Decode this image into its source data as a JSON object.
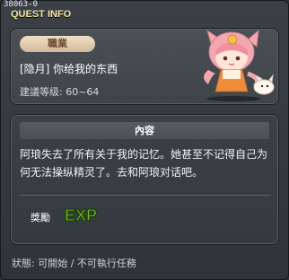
{
  "window": {
    "id": "38063-0",
    "title": "QUEST INFO"
  },
  "profile": {
    "job_badge": "職業",
    "quest_name": "[隐月] 你给我的东西",
    "level_range": "建議等级: 60~64"
  },
  "content": {
    "header": "內容",
    "text": "阿琅失去了所有关于我的记忆。她甚至不记得自己为何无法操纵精灵了。去和阿琅对话吧。"
  },
  "reward": {
    "label": "獎勵",
    "exp_label": "EXP"
  },
  "status": {
    "line": "狀態: 可開始 / 不可執行任務"
  },
  "colors": {
    "title": "#f4e7a1",
    "exp_green": "#99e03c"
  }
}
